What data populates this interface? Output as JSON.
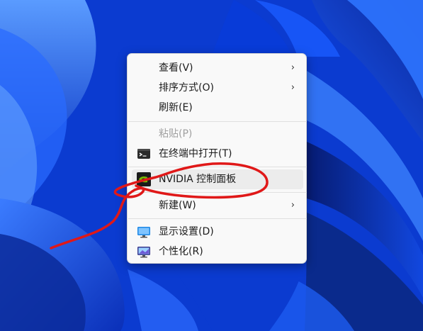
{
  "context_menu": {
    "items": [
      {
        "label": "查看(V)",
        "has_submenu": true
      },
      {
        "label": "排序方式(O)",
        "has_submenu": true
      },
      {
        "label": "刷新(E)"
      },
      {
        "label": "粘贴(P)",
        "disabled": true
      },
      {
        "label": "在终端中打开(T)",
        "icon": "terminal-icon"
      },
      {
        "label": "NVIDIA 控制面板",
        "icon": "nvidia-icon",
        "hovered": true
      },
      {
        "label": "新建(W)",
        "has_submenu": true
      },
      {
        "label": "显示设置(D)",
        "icon": "display-settings-icon"
      },
      {
        "label": "个性化(R)",
        "icon": "personalize-icon"
      }
    ],
    "submenu_glyph": "›"
  },
  "colors": {
    "desktop_blue": "#0a3fd6",
    "menu_bg": "#f9f9f9",
    "hover_bg": "#ececec",
    "annotation_red": "#e01818",
    "nvidia_green": "#76b900"
  }
}
